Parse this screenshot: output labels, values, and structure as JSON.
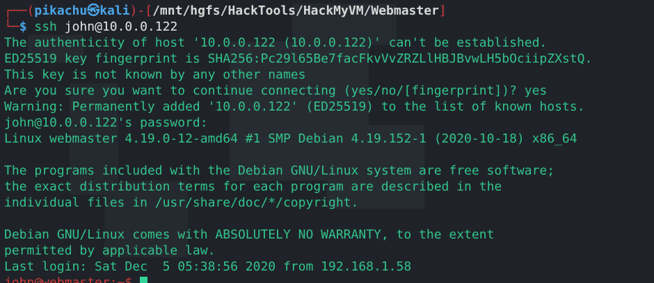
{
  "prompt": {
    "user": "pikachu",
    "at_symbol": "㉿",
    "host": "kali",
    "path": "/mnt/hgfs/HackTools/HackMyVM/Webmaster",
    "dollar": "$",
    "command": "ssh",
    "args": "john@10.0.0.122"
  },
  "output_lines": [
    "The authenticity of host '10.0.0.122 (10.0.0.122)' can't be established.",
    "ED25519 key fingerprint is SHA256:Pc29l65Be7facFkvVvZRZLlHBJBvwLH5bOciipZXstQ.",
    "This key is not known by any other names",
    "Are you sure you want to continue connecting (yes/no/[fingerprint])? yes",
    "Warning: Permanently added '10.0.0.122' (ED25519) to the list of known hosts.",
    "john@10.0.0.122's password:",
    "Linux webmaster 4.19.0-12-amd64 #1 SMP Debian 4.19.152-1 (2020-10-18) x86_64",
    "",
    "The programs included with the Debian GNU/Linux system are free software;",
    "the exact distribution terms for each program are described in the",
    "individual files in /usr/share/doc/*/copyright.",
    "",
    "Debian GNU/Linux comes with ABSOLUTELY NO WARRANTY, to the extent",
    "permitted by applicable law.",
    "Last login: Sat Dec  5 05:38:56 2020 from 192.168.1.58"
  ],
  "remote_prompt": "john@webmaster:~$ ",
  "colors": {
    "background": "#1f2329",
    "output_text": "#33c48a",
    "bracket": "#cf3a3a",
    "user": "#4aa6e8",
    "cursor": "#34d39a"
  }
}
